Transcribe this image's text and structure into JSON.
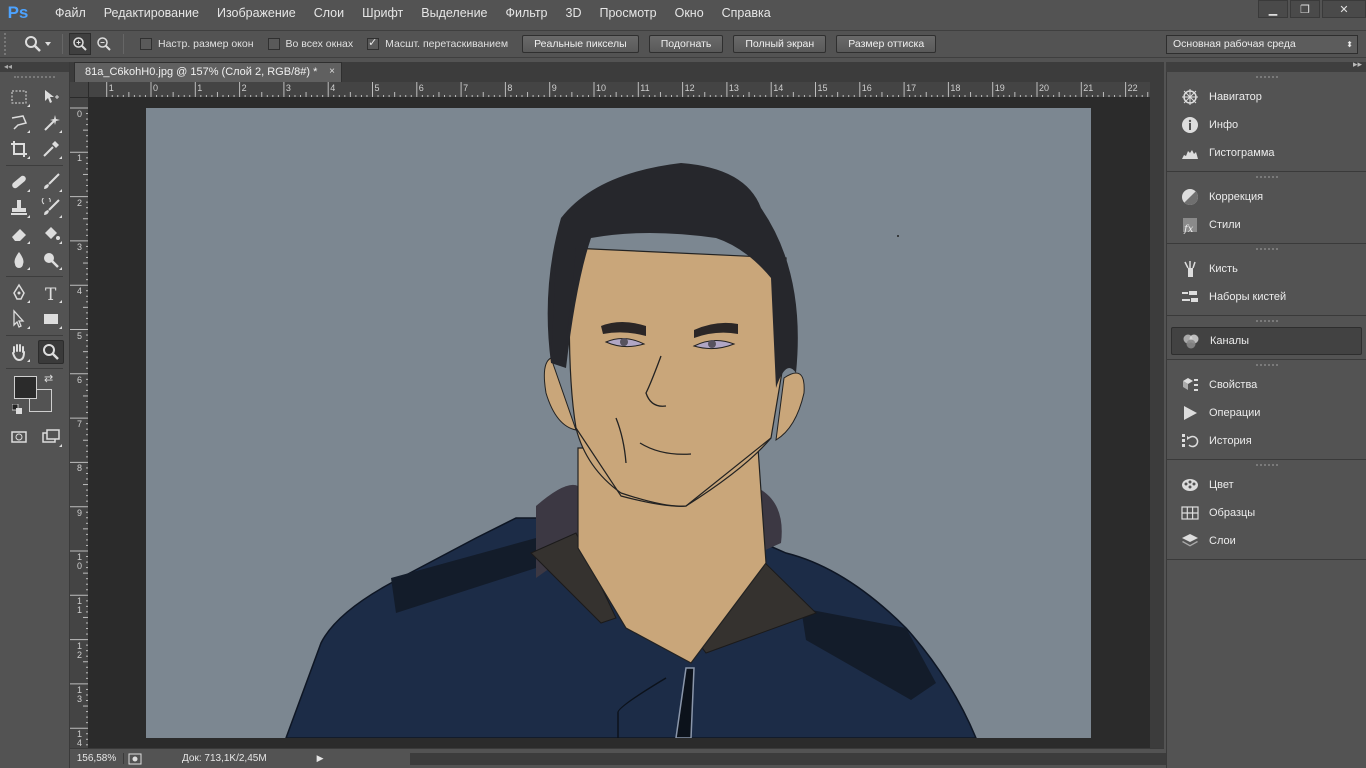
{
  "app": {
    "logo": "Ps"
  },
  "menu": [
    "Файл",
    "Редактирование",
    "Изображение",
    "Слои",
    "Шрифт",
    "Выделение",
    "Фильтр",
    "3D",
    "Просмотр",
    "Окно",
    "Справка"
  ],
  "window_controls": {
    "minimize": "▁",
    "restore": "❐",
    "close": "✕"
  },
  "options": {
    "resize_windows": "Настр. размер окон",
    "all_windows": "Во всех окнах",
    "scrubby_zoom": "Масшт. перетаскиванием",
    "actual_pixels": "Реальные пикселы",
    "fit_screen": "Подогнать",
    "fill_screen": "Полный экран",
    "print_size": "Размер оттиска",
    "workspace": "Основная рабочая среда"
  },
  "checkboxes": {
    "resize_windows": false,
    "all_windows": false,
    "scrubby_zoom": true
  },
  "document": {
    "tab_title": "81a_C6kohH0.jpg @ 157% (Слой 2, RGB/8#) *",
    "close": "×",
    "canvas_bg": "#7c8791"
  },
  "rulers": {
    "top": [
      "1",
      "0",
      "1",
      "2",
      "3",
      "4",
      "5",
      "6",
      "7",
      "8",
      "9",
      "10",
      "11",
      "12",
      "13",
      "14",
      "15",
      "16",
      "17",
      "18",
      "19",
      "20",
      "21",
      "22"
    ],
    "left": [
      "0",
      "1",
      "2",
      "3",
      "4",
      "5",
      "6",
      "7",
      "8",
      "9",
      "1\n0",
      "1\n1",
      "1\n2",
      "1\n3",
      "1\n4"
    ]
  },
  "status": {
    "zoom": "156,58%",
    "doc": "Док: 713,1K/2,45M",
    "arrow": "▶"
  },
  "panels": [
    {
      "group": 1,
      "items": [
        {
          "label": "Навигатор",
          "icon": "navigator-icon"
        },
        {
          "label": "Инфо",
          "icon": "info-icon"
        },
        {
          "label": "Гистограмма",
          "icon": "histogram-icon"
        }
      ]
    },
    {
      "group": 2,
      "items": [
        {
          "label": "Коррекция",
          "icon": "adjustments-icon"
        },
        {
          "label": "Стили",
          "icon": "styles-icon"
        }
      ]
    },
    {
      "group": 3,
      "items": [
        {
          "label": "Кисть",
          "icon": "brush-icon"
        },
        {
          "label": "Наборы кистей",
          "icon": "brush-presets-icon"
        }
      ]
    },
    {
      "group": 4,
      "items": [
        {
          "label": "Каналы",
          "icon": "channels-icon"
        }
      ]
    },
    {
      "group": 5,
      "items": [
        {
          "label": "Свойства",
          "icon": "properties-icon"
        },
        {
          "label": "Операции",
          "icon": "actions-icon"
        },
        {
          "label": "История",
          "icon": "history-icon"
        }
      ]
    },
    {
      "group": 6,
      "items": [
        {
          "label": "Цвет",
          "icon": "color-icon"
        },
        {
          "label": "Образцы",
          "icon": "swatches-icon"
        },
        {
          "label": "Слои",
          "icon": "layers-icon"
        }
      ]
    }
  ],
  "colors": {
    "foreground": "#2b2b2b",
    "background": "#535353",
    "accent": "#4da3ff"
  }
}
